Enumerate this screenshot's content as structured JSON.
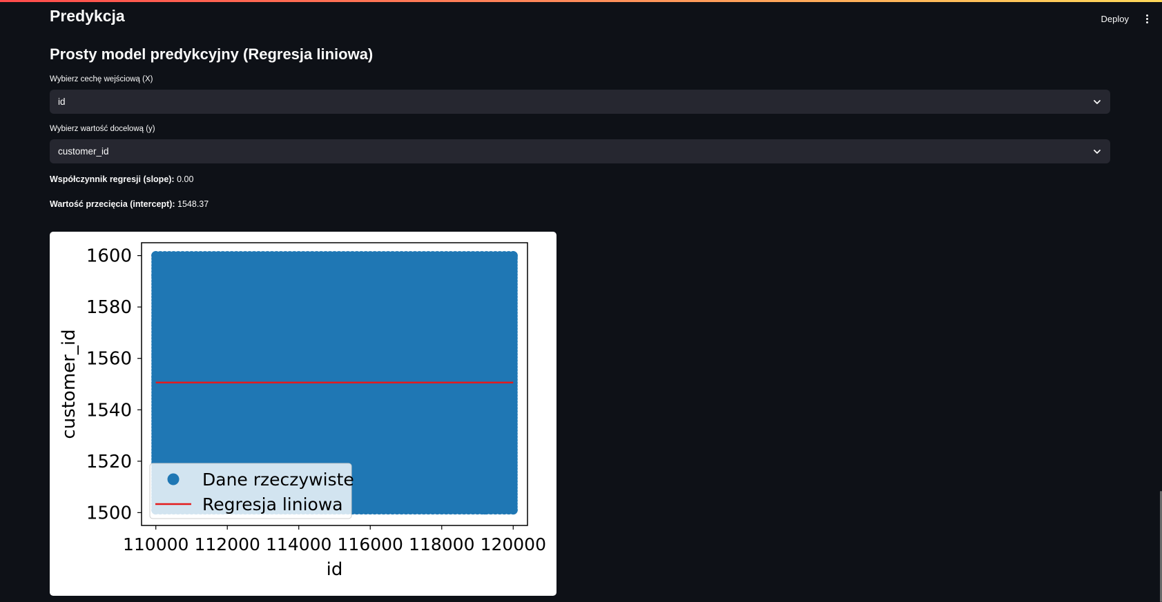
{
  "header": {
    "title": "Predykcja",
    "deploy_label": "Deploy"
  },
  "main": {
    "subtitle": "Prosty model predykcyjny (Regresja liniowa)",
    "x_select": {
      "label": "Wybierz cechę wejściową (X)",
      "value": "id"
    },
    "y_select": {
      "label": "Wybierz wartość docelową (y)",
      "value": "customer_id"
    },
    "slope": {
      "label": "Współczynnik regresji (slope):",
      "value": "0.00"
    },
    "intercept": {
      "label": "Wartość przecięcia (intercept):",
      "value": "1548.37"
    }
  },
  "chart_data": {
    "type": "scatter",
    "xlabel": "id",
    "ylabel": "customer_id",
    "xlim": [
      110000,
      120000
    ],
    "ylim": [
      1500,
      1600
    ],
    "x_ticks": [
      "110000",
      "112000",
      "114000",
      "116000",
      "118000",
      "120000"
    ],
    "y_ticks": [
      "1500",
      "1520",
      "1540",
      "1560",
      "1580",
      "1600"
    ],
    "series": [
      {
        "name": "Dane rzeczywiste",
        "kind": "scatter",
        "color": "#1f77b4",
        "x_range": [
          110000,
          120000
        ],
        "y_range": [
          1501,
          1600
        ]
      },
      {
        "name": "Regresja liniowa",
        "kind": "line",
        "color": "#e41a1c",
        "x": [
          110000,
          120000
        ],
        "y": [
          1550.6,
          1550.6
        ]
      }
    ],
    "legend_position": "lower-left",
    "grid": false
  }
}
